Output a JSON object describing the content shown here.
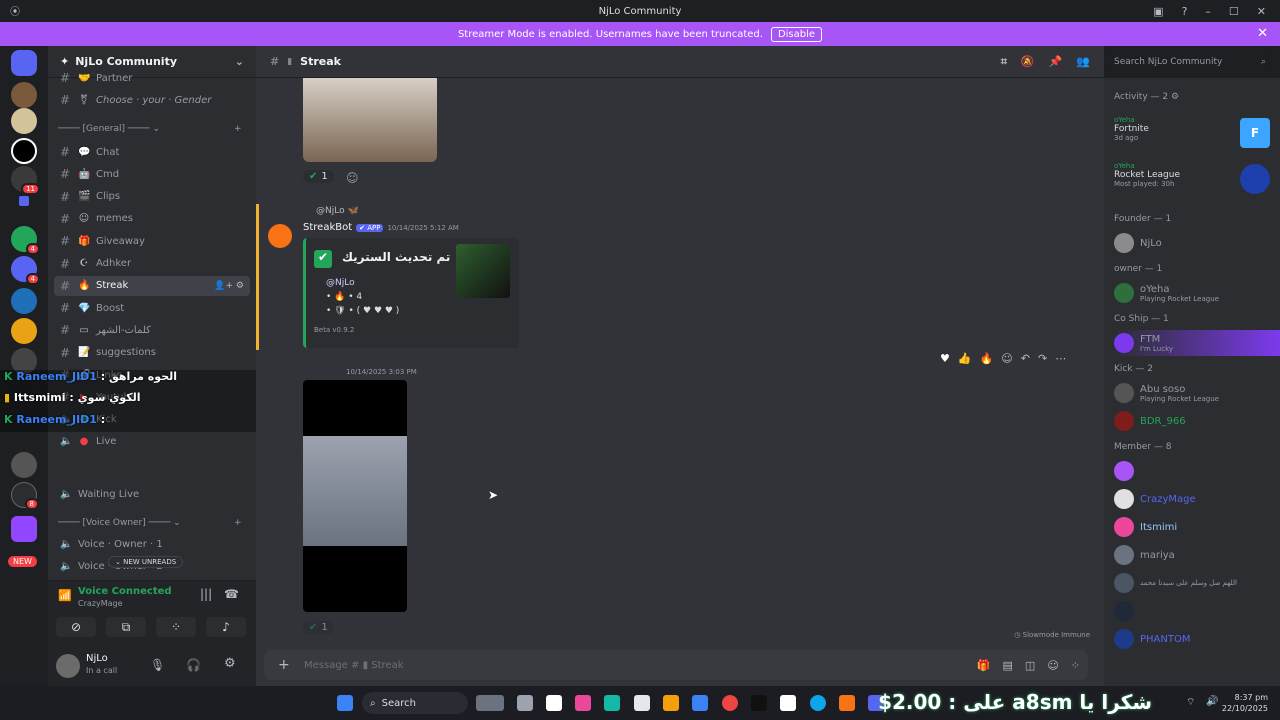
{
  "titlebar": {
    "title": "NjLo Community"
  },
  "banner": {
    "text": "Streamer Mode is enabled. Usernames have been truncated.",
    "button": "Disable"
  },
  "rail": {
    "badges": [
      "11",
      "4",
      "4",
      "8",
      "NEW"
    ]
  },
  "sidebar": {
    "server_name": "NjLo Community",
    "channels_top": [
      {
        "label": "Partner",
        "icon": "handshake-icon"
      },
      {
        "label": "Choose · your · Gender",
        "icon": "gender-icon"
      }
    ],
    "category_general": "[General]",
    "channels": [
      {
        "label": "Chat",
        "icon": "speech-bubble-icon"
      },
      {
        "label": "Cmd",
        "icon": "robot-icon"
      },
      {
        "label": "Clips",
        "icon": "clapper-icon"
      },
      {
        "label": "memes",
        "icon": "emoji-icon"
      },
      {
        "label": "Giveaway",
        "icon": "gift-icon"
      },
      {
        "label": "Adhker",
        "icon": "prayer-icon"
      },
      {
        "label": "Streak",
        "icon": "flame-icon"
      },
      {
        "label": "Boost",
        "icon": "gem-icon"
      },
      {
        "label": "كلمات-الشهر",
        "icon": "screen-icon"
      },
      {
        "label": "suggestions",
        "icon": "note-icon"
      },
      {
        "label": "Links",
        "icon": "link-icon"
      },
      {
        "label": "Youtube",
        "icon": "youtube-icon"
      },
      {
        "label": "Kick",
        "icon": "green-dot-icon"
      },
      {
        "label": "Live",
        "icon": "red-dot-icon"
      }
    ],
    "waiting_live": "Waiting Live",
    "category_voice": "[Voice Owner]",
    "voice_channels": [
      "Voice · Owner · 1",
      "Voice · Owner · 2"
    ],
    "new_unreads": "NEW UNREADS"
  },
  "ticker": [
    {
      "user": "Raneem_JID1",
      "text": "الحوه مراهق"
    },
    {
      "user": "Ittsmimi",
      "text": "الكوي سوي"
    },
    {
      "user": "Raneem_JID1",
      "text": ""
    }
  ],
  "voice": {
    "status": "Voice Connected",
    "channel": "CrazyMage"
  },
  "user": {
    "name": "NjLo",
    "status": "In a call"
  },
  "chat": {
    "channel": "Streak",
    "messages": [
      {
        "reaction_count": "1"
      },
      {
        "author": "@NjLo",
        "bot": "StreakBot",
        "tag": "APP",
        "time": "10/14/2025 5:12 AM",
        "embed_title": "تم تحديث الستريك",
        "embed_user": "@NjLo",
        "embed_count": "4",
        "embed_hearts": "( ♥ ♥ ♥ )",
        "footer": "Beta v0.9.2"
      },
      {
        "time": "10/14/2025 3:03 PM",
        "reaction_count": "1"
      }
    ],
    "composer_placeholder": "Message #",
    "composer_channel": "Streak",
    "slowmode": "Slowmode Immune"
  },
  "search": {
    "placeholder": "Search NjLo Community"
  },
  "members": {
    "activity_header": "Activity — 2",
    "activities": [
      {
        "user": "oYeha",
        "game": "Fortnite",
        "sub": "3d ago"
      },
      {
        "user": "oYeha",
        "game": "Rocket League",
        "sub": "Most played: 30h"
      }
    ],
    "groups": [
      {
        "title": "Founder — 1",
        "members": [
          {
            "name": "NjLo",
            "status": ""
          }
        ]
      },
      {
        "title": "owner — 1",
        "members": [
          {
            "name": "oYeha",
            "status": "Playing Rocket League"
          }
        ]
      },
      {
        "title": "Co Ship — 1",
        "members": [
          {
            "name": "FTM",
            "status": "I'm Lucky"
          }
        ]
      },
      {
        "title": "Kick — 2",
        "members": [
          {
            "name": "Abu soso",
            "status": "Playing Rocket League"
          },
          {
            "name": "BDR_966",
            "status": ""
          }
        ]
      },
      {
        "title": "Member — 8",
        "members": [
          {
            "name": "",
            "status": ""
          },
          {
            "name": "CrazyMage",
            "status": ""
          },
          {
            "name": "Itsmimi",
            "status": ""
          },
          {
            "name": "mariya",
            "status": ""
          },
          {
            "name": "",
            "status": "اللهم صل وسلم على سيدنا محمد"
          },
          {
            "name": "",
            "status": ""
          },
          {
            "name": "PHANTOM",
            "status": ""
          }
        ]
      }
    ]
  },
  "taskbar": {
    "search": "Search",
    "overlay": "شكرا يا a8sm على : 2.00$",
    "time": "8:37 pm",
    "date": "22/10/2025"
  },
  "colors": {
    "accent": "#a855f7",
    "blurple": "#5865f2",
    "green": "#23a55a"
  }
}
